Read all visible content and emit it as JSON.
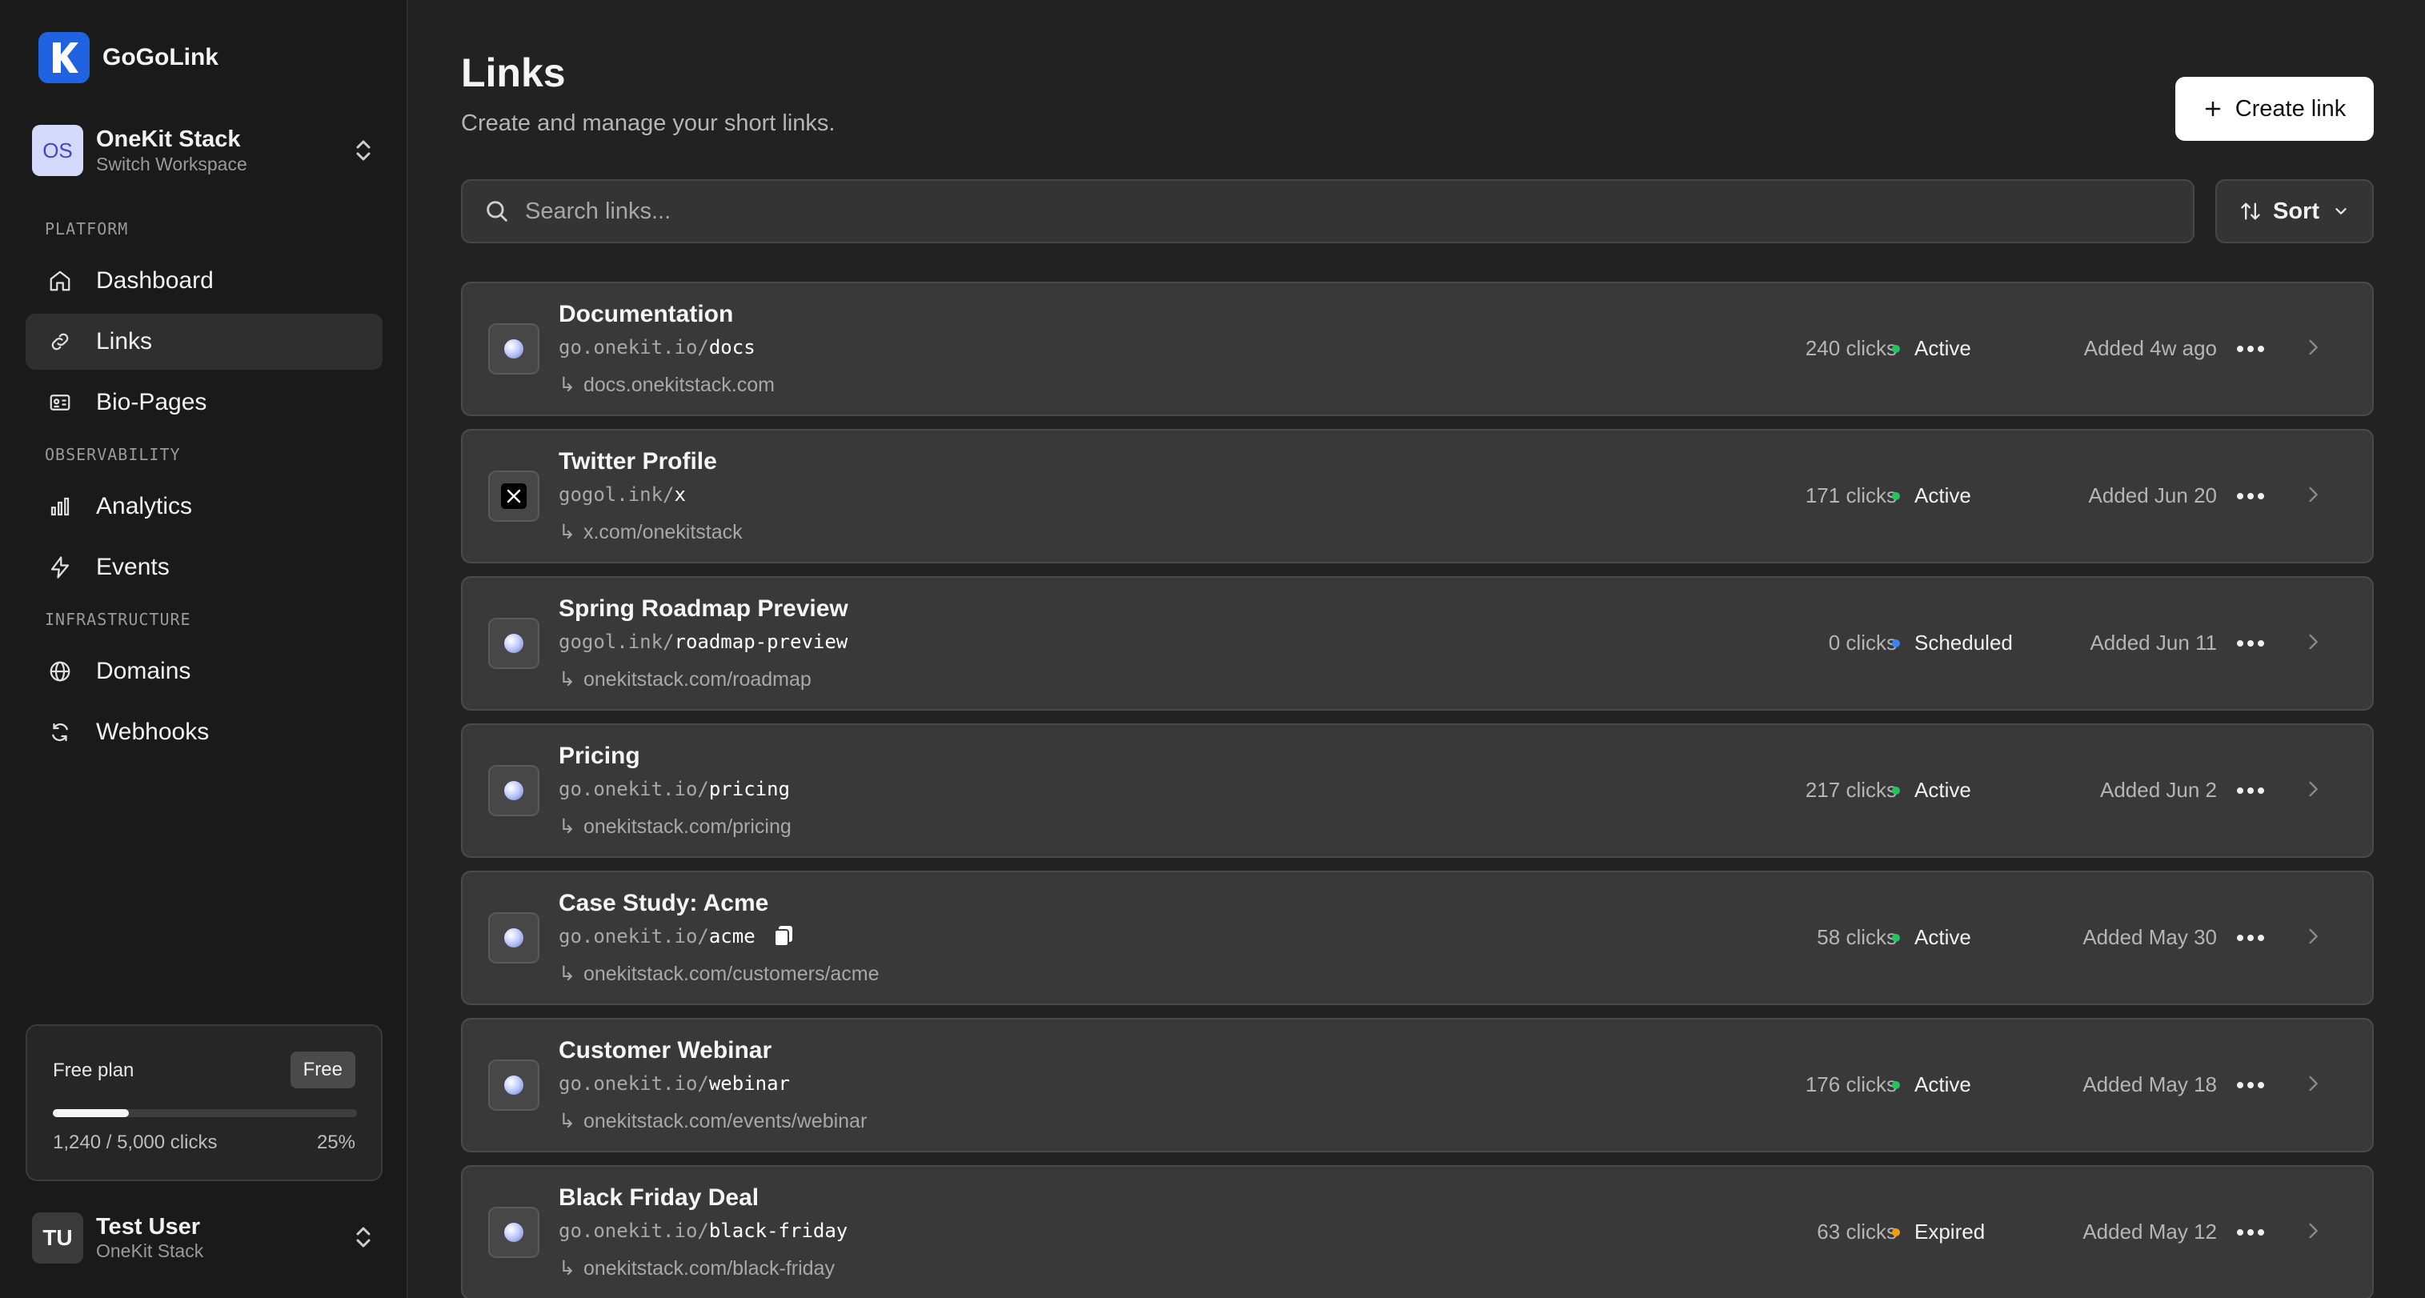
{
  "app": {
    "name": "GoGoLink",
    "logo_letter": "K",
    "brand_color": "#1f63e0"
  },
  "workspace": {
    "initials": "OS",
    "name": "OneKit Stack",
    "subtitle": "Switch Workspace"
  },
  "sidebar": {
    "sections": [
      "PLATFORM",
      "OBSERVABILITY",
      "INFRASTRUCTURE"
    ],
    "items": [
      {
        "label": "Dashboard",
        "icon": "home-icon",
        "active": false
      },
      {
        "label": "Links",
        "icon": "link-icon",
        "active": true
      },
      {
        "label": "Bio-Pages",
        "icon": "id-card-icon",
        "active": false
      },
      {
        "label": "Analytics",
        "icon": "bar-chart-icon",
        "active": false
      },
      {
        "label": "Events",
        "icon": "lightning-icon",
        "active": false
      },
      {
        "label": "Domains",
        "icon": "globe-icon",
        "active": false
      },
      {
        "label": "Webhooks",
        "icon": "refresh-icon",
        "active": false
      }
    ]
  },
  "plan": {
    "title": "Free plan",
    "badge": "Free",
    "usage": "1,240 / 5,000 clicks",
    "percent_label": "25%",
    "fraction": 0.25
  },
  "user": {
    "initials": "TU",
    "name": "Test User",
    "subtitle": "OneKit Stack"
  },
  "header": {
    "title": "Links",
    "subtitle": "Create and manage your short links.",
    "create_label": "Create link"
  },
  "search": {
    "placeholder": "Search links...",
    "value": ""
  },
  "sort": {
    "label": "Sort"
  },
  "status_colors": {
    "Active": "#22c55e",
    "Scheduled": "#3b82f6",
    "Expired": "#f59e0b"
  },
  "links": [
    {
      "title": "Documentation",
      "domain": "go.onekit.io/",
      "slug": "docs",
      "destination": "docs.onekitstack.com",
      "clicks": "240 clicks",
      "status": "Active",
      "added": "Added 4w ago",
      "favicon": "globe"
    },
    {
      "title": "Twitter Profile",
      "domain": "gogol.ink/",
      "slug": "x",
      "destination": "x.com/onekitstack",
      "clicks": "171 clicks",
      "status": "Active",
      "added": "Added Jun 20",
      "favicon": "x"
    },
    {
      "title": "Spring Roadmap Preview",
      "domain": "gogol.ink/",
      "slug": "roadmap-preview",
      "destination": "onekitstack.com/roadmap",
      "clicks": "0 clicks",
      "status": "Scheduled",
      "added": "Added Jun 11",
      "favicon": "globe"
    },
    {
      "title": "Pricing",
      "domain": "go.onekit.io/",
      "slug": "pricing",
      "destination": "onekitstack.com/pricing",
      "clicks": "217 clicks",
      "status": "Active",
      "added": "Added Jun 2",
      "favicon": "globe"
    },
    {
      "title": "Case Study: Acme",
      "domain": "go.onekit.io/",
      "slug": "acme",
      "destination": "onekitstack.com/customers/acme",
      "clicks": "58 clicks",
      "status": "Active",
      "added": "Added May 30",
      "favicon": "globe",
      "show_copy": true
    },
    {
      "title": "Customer Webinar",
      "domain": "go.onekit.io/",
      "slug": "webinar",
      "destination": "onekitstack.com/events/webinar",
      "clicks": "176 clicks",
      "status": "Active",
      "added": "Added May 18",
      "favicon": "globe"
    },
    {
      "title": "Black Friday Deal",
      "domain": "go.onekit.io/",
      "slug": "black-friday",
      "destination": "onekitstack.com/black-friday",
      "clicks": "63 clicks",
      "status": "Expired",
      "added": "Added May 12",
      "favicon": "globe"
    }
  ]
}
